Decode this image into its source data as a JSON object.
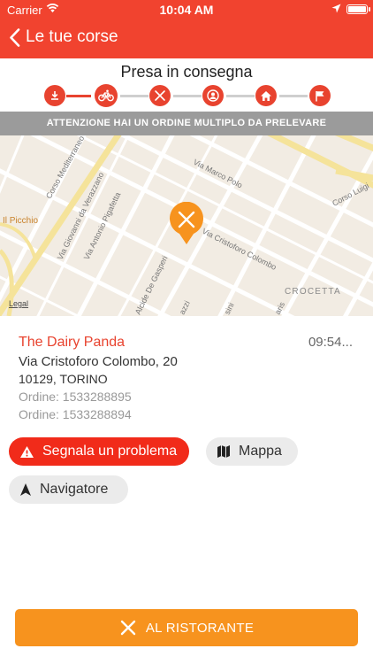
{
  "status_bar": {
    "carrier": "Carrier",
    "time": "10:04 AM"
  },
  "nav": {
    "back_label": "Le tue corse"
  },
  "header": {
    "title": "Presa in consegna",
    "steps": [
      {
        "icon": "download-icon",
        "state": "done"
      },
      {
        "icon": "bicycle-icon",
        "state": "active"
      },
      {
        "icon": "fork-knife-icon",
        "state": "pending"
      },
      {
        "icon": "user-icon",
        "state": "pending"
      },
      {
        "icon": "home-icon",
        "state": "pending"
      },
      {
        "icon": "flag-icon",
        "state": "pending"
      }
    ]
  },
  "banner": {
    "text": "ATTENZIONE HAI UN ORDINE MULTIPLO DA PRELEVARE"
  },
  "map": {
    "labels": {
      "corso_mediterraneo": "Corso Mediterraneo",
      "via_verrazzano": "Via Giovanni da Verazzano",
      "via_pigafetta": "Via Antonio Pigafetta",
      "via_marco_polo": "Via Marco Polo",
      "via_colombo": "Via Cristoforo Colombo",
      "corso_luigi": "Corso Luigi",
      "crocetta": "CROCETTA",
      "il_picchio": "Il Picchio",
      "alcide": "Alcide De Gasperi",
      "azzi": "azzi",
      "sini": "sini",
      "aris": "aris",
      "legal": "Legal"
    },
    "colors": {
      "background": "#f2ece3",
      "major_road": "#f7e7a3",
      "pin": "#f7931e"
    }
  },
  "details": {
    "restaurant_name": "The Dairy Panda",
    "eta": "09:54...",
    "address": "Via Cristoforo Colombo, 20",
    "city": "10129, TORINO",
    "orders": [
      "Ordine: 1533288895",
      "Ordine: 1533288894"
    ]
  },
  "actions": {
    "report_problem": "Segnala un problema",
    "map": "Mappa",
    "navigator": "Navigatore"
  },
  "cta": {
    "label": "AL RISTORANTE"
  },
  "colors": {
    "accent": "#f1432f",
    "alert": "#f12b1a",
    "cta": "#f7931e"
  }
}
